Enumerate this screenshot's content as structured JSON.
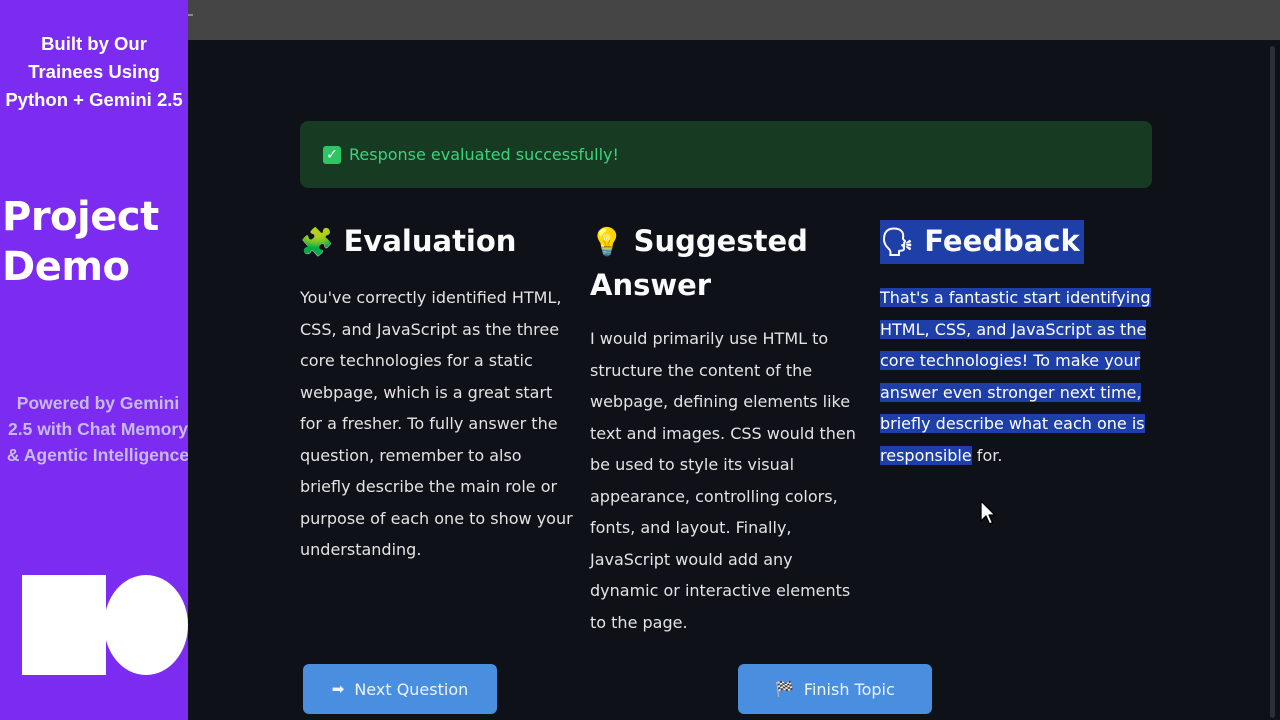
{
  "promo": {
    "top_text": "Built by Our Trainees Using Python + Gemini 2.5",
    "title": "Project Demo",
    "powered": "Powered by Gemini 2.5 with Chat Memory & Agentic Intelligence"
  },
  "alert": {
    "icon": "check-icon",
    "text": "Response evaluated successfully!"
  },
  "evaluation": {
    "emoji": "🧩",
    "title": "Evaluation",
    "body": "You've correctly identified HTML, CSS, and JavaScript as the three core technologies for a static webpage, which is a great start for a fresher. To fully answer the question, remember to also briefly describe the main role or purpose of each one to show your understanding."
  },
  "suggested": {
    "emoji": "💡",
    "title": "Suggested Answer",
    "body": "I would primarily use HTML to structure the content of the webpage, defining elements like text and images. CSS would then be used to style its visual appearance, controlling colors, fonts, and layout. Finally, JavaScript would add any dynamic or interactive elements to the page."
  },
  "feedback": {
    "emoji": "🗣",
    "title": "Feedback",
    "body_selected": "That's a fantastic start identifying HTML, CSS, and JavaScript as the core technologies! To make your answer even stronger next time, briefly describe what each one is responsible",
    "body_rest": " for."
  },
  "buttons": {
    "next_icon": "➡",
    "next_label": "Next Question",
    "finish_icon": "🏁",
    "finish_label": "Finish Topic"
  },
  "colors": {
    "promo_bg": "#7b2cf0",
    "app_bg": "#0e1117",
    "alert_bg": "#173a22",
    "alert_text": "#3ed27a",
    "selection": "#1f3fa8",
    "button_bg": "#4a8ee0"
  }
}
